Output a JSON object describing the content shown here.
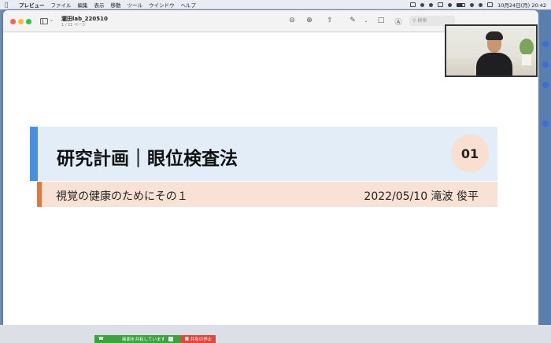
{
  "menubar": {
    "apple": "",
    "items": [
      "プレビュー",
      "ファイル",
      "編集",
      "表示",
      "移動",
      "ツール",
      "ウインドウ",
      "ヘルプ"
    ],
    "datetime": "10月24日(月)  20:42"
  },
  "window": {
    "doc_title": "瀧田lab_220510",
    "doc_sub": "1 / 21 ページ",
    "search_placeholder": "検索",
    "toolbar_icons": [
      "zoom-out-icon",
      "zoom-in-icon",
      "share-icon",
      "markup-pen-icon",
      "rotate-icon",
      "annotate-icon",
      "search-icon"
    ]
  },
  "slide": {
    "title": "研究計画｜眼位検査法",
    "number": "01",
    "subtitle_left": "視覚の健康のためにその１",
    "subtitle_right": "2022/05/10 滝波 俊平"
  },
  "sharebar": {
    "label": "画面を共有しています",
    "stop_label": "共有の停止"
  },
  "colors": {
    "title_band": "#e2edf8",
    "title_accent": "#4a90e2",
    "sub_band": "#f8e2d6",
    "sub_accent": "#e07a3a",
    "number_circle": "#f9dfd0",
    "share_green": "#3ba33d",
    "stop_red": "#e2463b"
  }
}
